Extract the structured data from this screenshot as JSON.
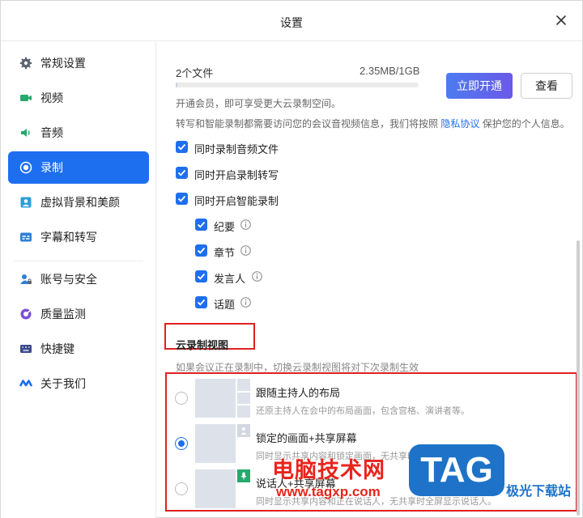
{
  "window": {
    "title": "设置"
  },
  "sidebar": {
    "items": [
      {
        "label": "常规设置",
        "icon": "gear-icon"
      },
      {
        "label": "视频",
        "icon": "video-icon"
      },
      {
        "label": "音频",
        "icon": "speaker-icon"
      },
      {
        "label": "录制",
        "icon": "record-icon",
        "active": true
      },
      {
        "label": "虚拟背景和美颜",
        "icon": "portrait-icon"
      },
      {
        "label": "字幕和转写",
        "icon": "subtitle-icon"
      },
      {
        "label": "账号与安全",
        "icon": "account-lock-icon"
      },
      {
        "label": "质量监测",
        "icon": "monitor-icon"
      },
      {
        "label": "快捷键",
        "icon": "keyboard-icon"
      },
      {
        "label": "关于我们",
        "icon": "logo-icon"
      }
    ]
  },
  "storage": {
    "files": "2个文件",
    "size": "2.35MB/1GB",
    "usage_fraction": 0.0023,
    "upgrade_label": "立即开通",
    "view_label": "查看",
    "hint": "开通会员，即可享受更大云录制空间。",
    "privacy_prefix": "转写和智能录制都需要访问您的会议音视频信息，我们将按照",
    "privacy_link": "隐私协议",
    "privacy_suffix": "保护您的个人信息。"
  },
  "options": [
    {
      "label": "同时录制音频文件",
      "checked": true
    },
    {
      "label": "同时开启录制转写",
      "checked": true
    },
    {
      "label": "同时开启智能录制",
      "checked": true
    }
  ],
  "sub_options": [
    {
      "label": "纪要",
      "checked": true
    },
    {
      "label": "章节",
      "checked": true
    },
    {
      "label": "发言人",
      "checked": true
    },
    {
      "label": "话题",
      "checked": true
    }
  ],
  "cloud_view": {
    "title": "云录制视图",
    "hint": "如果会议正在录制中，切换云录制视图将对下次录制生效",
    "layouts": [
      {
        "title": "跟随主持人的布局",
        "desc": "还原主持人在会中的布局画面，包含宫格、演讲者等。",
        "selected": false
      },
      {
        "title": "锁定的画面+共享屏幕",
        "desc": "同时显示共享内容和锁定画面，无共享时全屏显示锁定画面。",
        "selected": true
      },
      {
        "title": "说话人+共享屏幕",
        "desc": "同时显示共享内容和正在说话人，无共享时全屏显示说话人。",
        "selected": false
      }
    ]
  },
  "watermark": {
    "brand": "电脑技术网",
    "url": "www.tagxp.com",
    "logo": "TAG",
    "site": "极光下载站"
  },
  "colors": {
    "accent": "#1e6ff0",
    "highlight_box": "#e02020",
    "watermark_red": "#e8241c",
    "watermark_blue": "#1e73c8"
  }
}
